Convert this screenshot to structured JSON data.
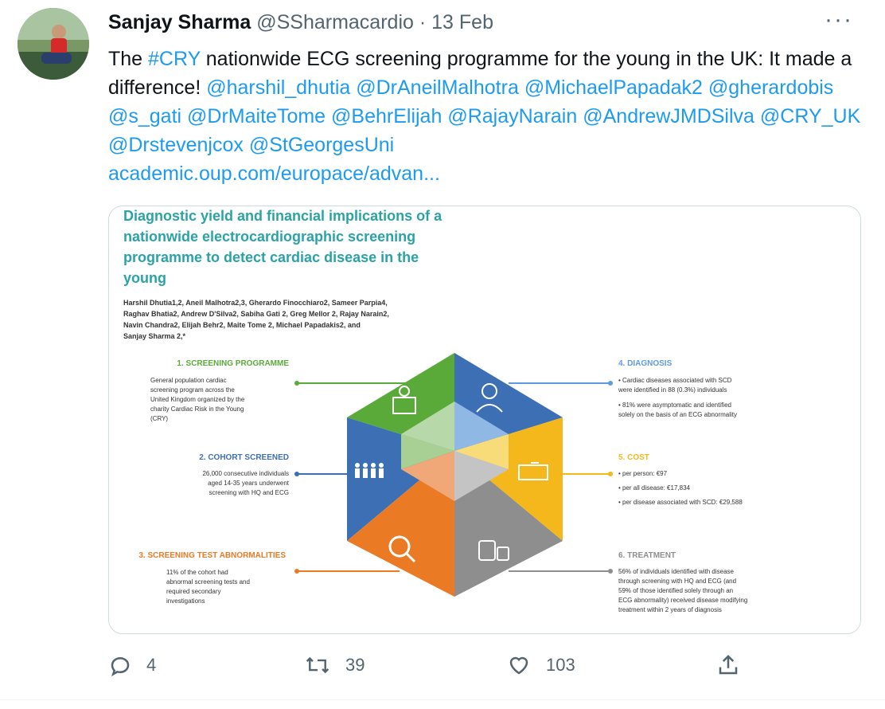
{
  "tweet": {
    "author_name": "Sanjay Sharma",
    "author_handle": "@SSharmacardio",
    "separator": "·",
    "date": "13 Feb",
    "more_icon": "ellipsis-icon",
    "text": {
      "t1": "The ",
      "hashtag": "#CRY",
      "t2": " nationwide ECG screening programme for the young in the UK: It made a difference! ",
      "mentions": [
        "@harshil_dhutia",
        "@DrAneilMalhotra",
        "@MichaelPapadak2",
        "@gherardobis",
        "@s_gati",
        "@DrMaiteTome",
        "@BehrElijah",
        "@RajayNarain",
        "@AndrewJMDSilva",
        "@CRY_UK",
        "@Drstevenjcox",
        "@StGeorgesUni"
      ],
      "link": "academic.oup.com/europace/advan..."
    }
  },
  "card": {
    "title_lines": [
      "Diagnostic yield and financial implications of a",
      "nationwide electrocardiographic screening",
      "programme to detect cardiac disease in the",
      "young"
    ],
    "author_lines": [
      "Harshil Dhutia1,2, Aneil Malhotra2,3, Gherardo Finocchiaro2, Sameer Parpia4,",
      "Raghav Bhatia2, Andrew D'Silva2, Sabiha Gati 2, Greg Mellor 2, Rajay Narain2,",
      "Navin Chandra2, Elijah Behr2, Maite Tome 2, Michael Papadakis2, and",
      "Sanjay Sharma 2,*"
    ],
    "sections": {
      "s1_title": "1. SCREENING PROGRAMME",
      "s1_text": [
        "General population cardiac",
        "screening program across the",
        "United Kingdom organized by the",
        "charity Cardiac Risk in the Young",
        "(CRY)"
      ],
      "s2_title": "2. COHORT SCREENED",
      "s2_text": [
        "26,000 consecutive individuals",
        "aged 14-35 years underwent",
        "screening with HQ and ECG"
      ],
      "s3_title": "3. SCREENING TEST ABNORMALITIES",
      "s3_text": [
        "11% of the cohort had",
        "abnormal screening tests and",
        "required secondary",
        "investigations"
      ],
      "s4_title": "4. DIAGNOSIS",
      "s4_text": [
        "• Cardiac diseases associated with SCD",
        "  were identified in 88 (0.3%) individuals",
        "• 81% were asymptomatic and identified",
        "  solely on the basis of an ECG abnormality"
      ],
      "s5_title": "5. COST",
      "s5_text": [
        "• per person: €97",
        "• per all disease: €17,834",
        "• per disease associated with SCD: €29,588"
      ],
      "s6_title": "6. TREATMENT",
      "s6_text": [
        "56% of individuals identified with disease",
        "through screening with HQ and ECG (and",
        "59% of those identified solely through an",
        "ECG abnormality) received disease modifying",
        "treatment within 2 years of diagnosis"
      ]
    },
    "colors": {
      "teal": "#2aa3a6",
      "green": "#5aaa3a",
      "blue": "#3c6fb4",
      "orange": "#ea7a24",
      "yellow": "#f4b81c",
      "gray": "#8e8e8e",
      "light_blue": "#5c9be0"
    }
  },
  "actions": {
    "reply": {
      "icon": "reply-icon",
      "count": "4"
    },
    "retweet": {
      "icon": "retweet-icon",
      "count": "39"
    },
    "like": {
      "icon": "heart-icon",
      "count": "103"
    },
    "share": {
      "icon": "share-icon"
    }
  }
}
